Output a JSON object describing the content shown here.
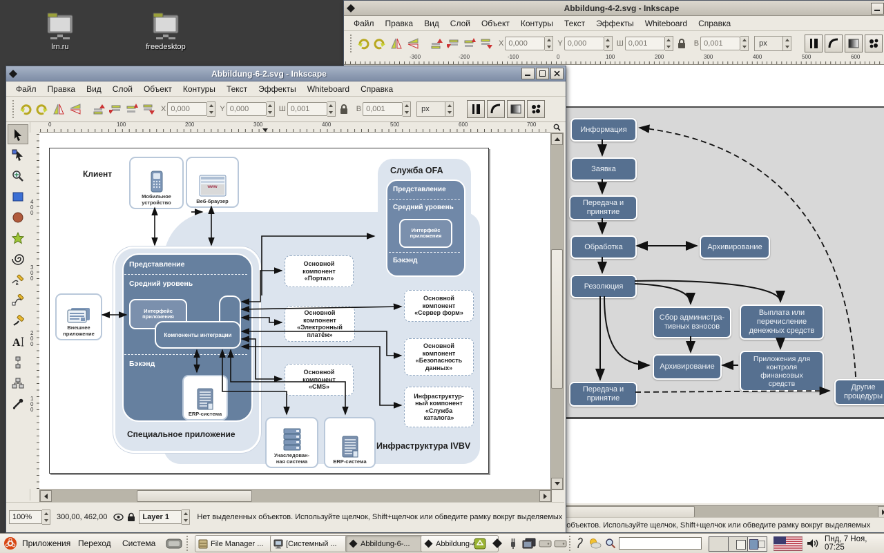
{
  "desktop": {
    "icons": [
      {
        "label": "lrn.ru"
      },
      {
        "label": "freedesktop"
      }
    ]
  },
  "menu_items": [
    "Файл",
    "Правка",
    "Вид",
    "Слой",
    "Объект",
    "Контуры",
    "Текст",
    "Эффекты",
    "Whiteboard",
    "Справка"
  ],
  "tool_controls": {
    "x_label": "X",
    "x_value": "0,000",
    "y_label": "Y",
    "y_value": "0,000",
    "w_label": "Ш",
    "w_value": "0,001",
    "h_label": "В",
    "h_value": "0,001",
    "unit": "px"
  },
  "front": {
    "title": "Abbildung-6-2.svg - Inkscape",
    "ruler_h": [
      "0",
      "100",
      "200",
      "300",
      "400",
      "500",
      "600",
      "700"
    ],
    "ruler_v": [
      "400",
      "300",
      "200",
      "100"
    ],
    "status": {
      "zoom": "100%",
      "coords": "300,00, 462,00",
      "layer": "Layer 1",
      "message": "Нет выделенных объектов. Используйте щелчок, Shift+щелчок или обведите рамку вокруг выделяемых"
    },
    "diagram": {
      "client": "Клиент",
      "mobile": "Мобильное\nустройство",
      "browser": "Веб-браузер",
      "www": "www",
      "ofa_title": "Служба OFA",
      "ofa_presentation": "Представление",
      "ofa_middle": "Средний уровень",
      "ofa_interface": "Интерфейс\nприложения",
      "ofa_backend": "Бэкэнд",
      "sp_presentation": "Представление",
      "sp_middle": "Средний уровень",
      "sp_interface": "Интерфейс\nприложения",
      "sp_integration": "Компоненты интеграции",
      "sp_backend": "Бэкэнд",
      "sp_erp": "ERP-система",
      "sp_label": "Специальное приложение",
      "external": "Внешнее\nприложение",
      "comp_portal": "Основной\nкомпонент\n«Портал»",
      "comp_epay": "Основной\nкомпонент\n«Электронный\nплатёж»",
      "comp_cms": "Основной\nкомпонент\n«CMS»",
      "comp_forms": "Основной\nкомпонент\n«Сервер форм»",
      "comp_security": "Основной\nкомпонент\n«Безопасность\nданных»",
      "comp_catalog": "Инфраструктур-\nный компонент\n«Служба\nкаталога»",
      "legacy": "Унаследован-\nная система",
      "erp2": "ERP-система",
      "infra": "Инфраструктура IVBV"
    }
  },
  "back": {
    "title": "Abbildung-4-2.svg - Inkscape",
    "ruler_h": [
      "-300",
      "-200",
      "-100",
      "0",
      "100",
      "200",
      "300",
      "400",
      "500",
      "600"
    ],
    "flow": [
      "Информация",
      "Заявка",
      "Передача и\nпринятие",
      "Обработка",
      "Архивирование",
      "Резолюция",
      "Сбор администра-\nтивных взносов",
      "Выплата или\nперечисление\nденежных средств",
      "Архивирование",
      "Приложения для\nконтроля\nфинансовых\nсредств",
      "Передача и\nпринятие",
      "Другие\nпроцедуры"
    ]
  },
  "taskbar": {
    "menus": [
      "Приложения",
      "Переход",
      "Система"
    ],
    "tasks": [
      "File Manager ...",
      "[Системный ...",
      "Abbildung-6-...",
      "Abbildung-4-..."
    ],
    "clock": "Пнд, 7 Ноя, 07:25"
  },
  "colors": {
    "flow_box": "#567090",
    "diagram_dark": "#66809f",
    "diagram_pale": "#dce4ee",
    "titlebar_active": "#8397b0",
    "desktop": "#3b3b3b"
  }
}
